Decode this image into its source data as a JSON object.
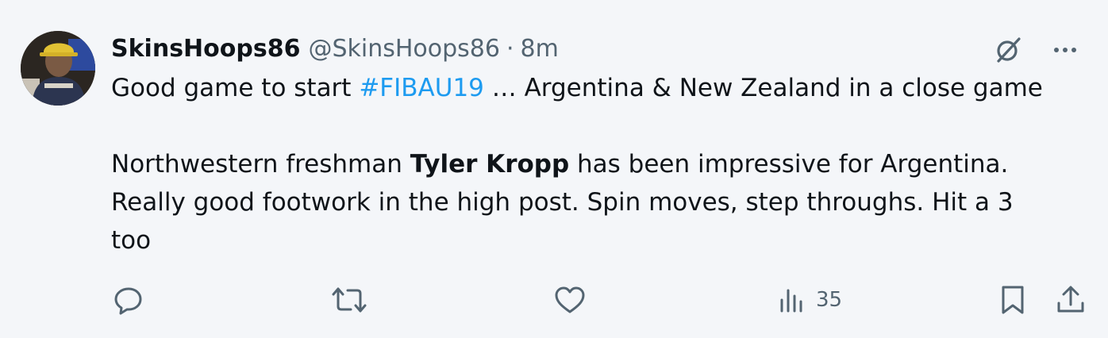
{
  "tweet": {
    "display_name": "SkinsHoops86",
    "handle": "@SkinsHoops86",
    "separator": "·",
    "time": "8m",
    "line1_prefix": "Good game to start ",
    "line1_hashtag": "#FIBAU19",
    "line1_suffix": " … Argentina & New Zealand in a close game",
    "line2_prefix": "Northwestern freshman ",
    "line2_bold": "Tyler Kropp",
    "line2_suffix": " has been impressive for Argentina.",
    "line3": "Really good footwork in the high post. Spin moves, step throughs. Hit a 3",
    "line4": "too"
  },
  "actions": {
    "views_count": "35"
  },
  "icons": {
    "grok": "grok-icon",
    "more": "more-icon",
    "reply": "reply-icon",
    "retweet": "retweet-icon",
    "like": "like-icon",
    "views": "views-icon",
    "bookmark": "bookmark-icon",
    "share": "share-icon"
  },
  "colors": {
    "text": "#0f1419",
    "secondary": "#536471",
    "hashtag": "#1d9bf0",
    "background": "#f4f6f9"
  }
}
